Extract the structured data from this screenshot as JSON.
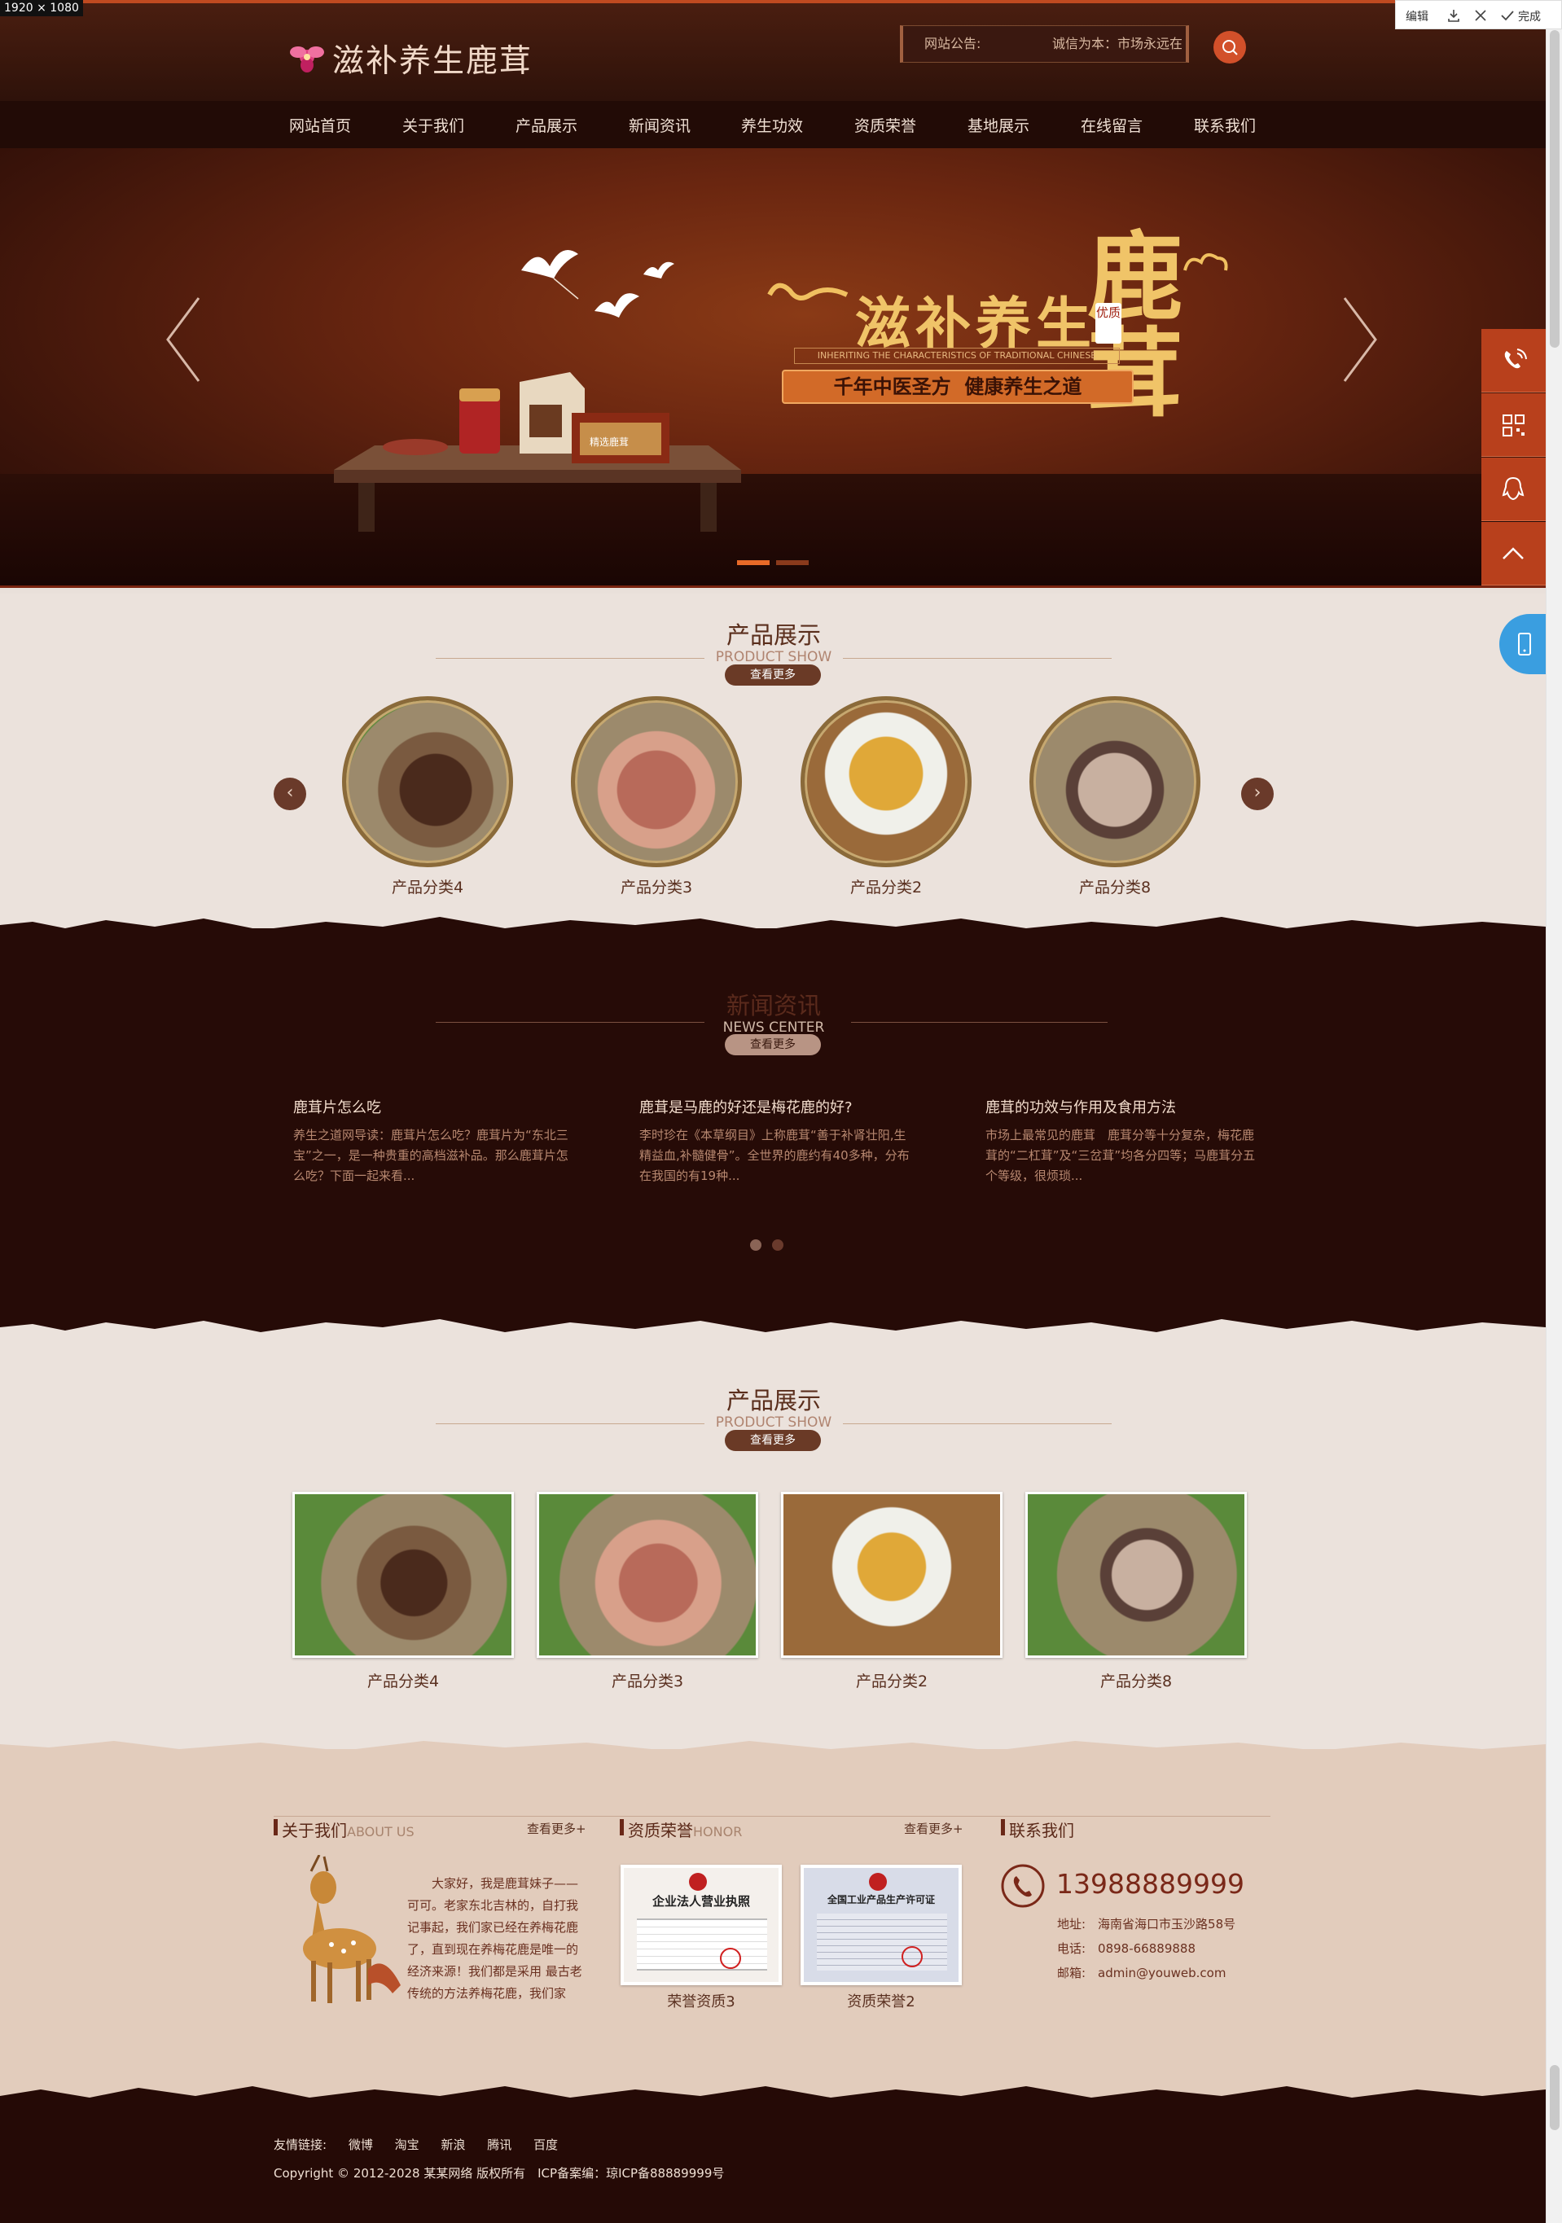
{
  "screen": {
    "resolution_label": "1920 × 1080"
  },
  "toolbar": {
    "edit": "编辑",
    "done": "完成"
  },
  "header": {
    "logo": "滋补养生鹿茸",
    "notice_label": "网站公告:",
    "notice_text": "诚信为本：市场永远在"
  },
  "nav": [
    "网站首页",
    "关于我们",
    "产品展示",
    "新闻资讯",
    "养生功效",
    "资质荣誉",
    "基地展示",
    "在线留言",
    "联系我们"
  ],
  "banner": {
    "title": "滋补养生",
    "title_big": "鹿茸",
    "stamp": "优质",
    "subtitle_en": "INHERITING THE CHARACTERISTICS OF TRADITIONAL CHINESE",
    "slogan": "千年中医圣方  健康养生之道",
    "box_label": "精选鹿茸",
    "slides": 2,
    "active_slide": 1
  },
  "products_circle": {
    "title": "产品展示",
    "subtitle": "PRODUCT SHOW",
    "more": "查看更多",
    "items": [
      "产品分类4",
      "产品分类3",
      "产品分类2",
      "产品分类8"
    ]
  },
  "news": {
    "title": "新闻资讯",
    "subtitle": "NEWS CENTER",
    "more": "查看更多",
    "items": [
      {
        "title": "鹿茸片怎么吃",
        "excerpt": "养生之道网导读：鹿茸片怎么吃？鹿茸片为“东北三宝”之一，是一种贵重的高档滋补品。那么鹿茸片怎么吃？下面一起来看..."
      },
      {
        "title": "鹿茸是马鹿的好还是梅花鹿的好?",
        "excerpt": "李时珍在《本草纲目》上称鹿茸“善于补肾壮阳,生精益血,补髓健骨”。全世界的鹿约有40多种，分布在我国的有19种..."
      },
      {
        "title": "鹿茸的功效与作用及食用方法",
        "excerpt": "市场上最常见的鹿茸　鹿茸分等十分复杂，梅花鹿茸的“二杠茸”及“三岔茸”均各分四等；马鹿茸分五个等级，很烦琐..."
      }
    ]
  },
  "products_square": {
    "title": "产品展示",
    "subtitle": "PRODUCT SHOW",
    "more": "查看更多",
    "items": [
      "产品分类4",
      "产品分类3",
      "产品分类2",
      "产品分类8"
    ]
  },
  "about": {
    "title": "关于我们",
    "title_en": "ABOUT US",
    "more": "查看更多+",
    "text": "大家好，我是鹿茸妹子——可可。老家东北吉林的，自打我记事起，我们家已经在养梅花鹿了，直到现在养梅花鹿是唯一的经济来源！我们都是采用 最古老传统的方法养梅花鹿，我们家"
  },
  "honor": {
    "title": "资质荣誉",
    "title_en": "HONOR",
    "more": "查看更多+",
    "items": [
      {
        "caption": "荣誉资质3",
        "cert_title": "企业法人营业执照"
      },
      {
        "caption": "资质荣誉2",
        "cert_title": "全国工业产品生产许可证"
      }
    ]
  },
  "contact": {
    "title": "联系我们",
    "phone": "13988889999",
    "address": "地址:　海南省海口市玉沙路58号",
    "tel": "电话:　0898-66889888",
    "email": "邮箱:　admin@youweb.com"
  },
  "footer": {
    "links_label": "友情链接:",
    "links": [
      "微博",
      "淘宝",
      "新浪",
      "腾讯",
      "百度"
    ],
    "copyright": "Copyright © 2012-2028 某某网络 版权所有　ICP备案编：琼ICP备88889999号"
  },
  "colors": {
    "brand": "#c04a20",
    "dark": "#260b07",
    "accent": "#d2502a",
    "paper": "#ebe2dc"
  }
}
